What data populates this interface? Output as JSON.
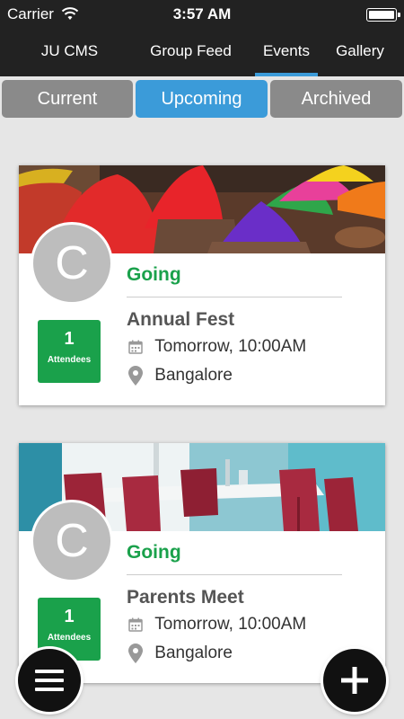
{
  "status_bar": {
    "carrier": "Carrier",
    "time": "3:57 AM",
    "icons": {
      "wifi": "wifi-icon",
      "battery": "battery-icon"
    }
  },
  "nav": {
    "items": [
      {
        "label": "JU CMS",
        "active": false
      },
      {
        "label": "Group Feed",
        "active": false
      },
      {
        "label": "Events",
        "active": true
      },
      {
        "label": "Gallery",
        "active": false
      }
    ],
    "accent_color": "#3b9bd9"
  },
  "segments": {
    "items": [
      {
        "label": "Current",
        "active": false
      },
      {
        "label": "Upcoming",
        "active": true
      },
      {
        "label": "Archived",
        "active": false
      }
    ],
    "inactive_color": "#8a8a8a",
    "active_color": "#3b9bd9"
  },
  "events": [
    {
      "avatar_letter": "C",
      "status": "Going",
      "attendee_count": "1",
      "attendee_label": "Attendees",
      "title": "Annual Fest",
      "datetime": "Tomorrow, 10:00AM",
      "location": "Bangalore",
      "banner": "colored-powder-photo"
    },
    {
      "avatar_letter": "C",
      "status": "Going",
      "attendee_count": "1",
      "attendee_label": "Attendees",
      "title": "Parents Meet",
      "datetime": "Tomorrow, 10:00AM",
      "location": "Bangalore",
      "banner": "meeting-room-photo"
    }
  ],
  "fabs": {
    "menu_icon": "hamburger-icon",
    "add_icon": "plus-icon"
  },
  "colors": {
    "status_green": "#1aa14b",
    "top_bar": "#222222",
    "background": "#e6e6e6"
  }
}
